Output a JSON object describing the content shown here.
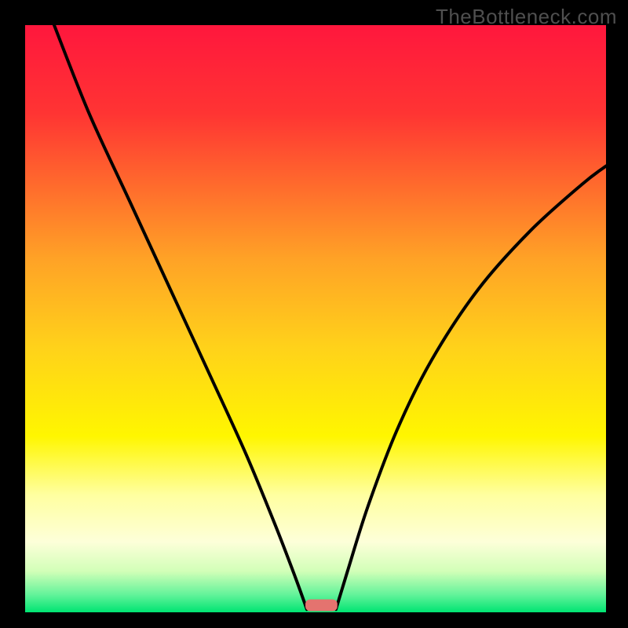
{
  "watermark": "TheBottleneck.com",
  "chart_data": {
    "type": "line",
    "title": "",
    "xlabel": "",
    "ylabel": "",
    "xlim": [
      0,
      100
    ],
    "ylim": [
      0,
      100
    ],
    "background_gradient_stops": [
      {
        "offset": 0.0,
        "color": "#ff173d"
      },
      {
        "offset": 0.15,
        "color": "#ff3433"
      },
      {
        "offset": 0.4,
        "color": "#ffa326"
      },
      {
        "offset": 0.55,
        "color": "#ffd21a"
      },
      {
        "offset": 0.7,
        "color": "#fff600"
      },
      {
        "offset": 0.8,
        "color": "#ffffa0"
      },
      {
        "offset": 0.88,
        "color": "#fdffd9"
      },
      {
        "offset": 0.93,
        "color": "#d2ffb8"
      },
      {
        "offset": 0.97,
        "color": "#63f39a"
      },
      {
        "offset": 1.0,
        "color": "#00e472"
      }
    ],
    "series": [
      {
        "name": "left-curve",
        "points": [
          {
            "x": 5.0,
            "y": 100.0
          },
          {
            "x": 11.0,
            "y": 85.0
          },
          {
            "x": 18.0,
            "y": 70.0
          },
          {
            "x": 25.0,
            "y": 55.0
          },
          {
            "x": 32.0,
            "y": 40.0
          },
          {
            "x": 38.0,
            "y": 27.0
          },
          {
            "x": 43.0,
            "y": 15.0
          },
          {
            "x": 46.5,
            "y": 6.0
          },
          {
            "x": 48.5,
            "y": 0.5
          }
        ]
      },
      {
        "name": "right-curve",
        "points": [
          {
            "x": 53.5,
            "y": 0.5
          },
          {
            "x": 55.5,
            "y": 7.0
          },
          {
            "x": 59.0,
            "y": 18.0
          },
          {
            "x": 64.0,
            "y": 31.0
          },
          {
            "x": 70.0,
            "y": 43.0
          },
          {
            "x": 78.0,
            "y": 55.0
          },
          {
            "x": 87.0,
            "y": 65.0
          },
          {
            "x": 96.0,
            "y": 73.0
          },
          {
            "x": 100.0,
            "y": 76.0
          }
        ]
      }
    ],
    "marker": {
      "x_center": 51.0,
      "width": 5.5,
      "height": 2.0,
      "y": 0.2,
      "color": "#e4736f"
    },
    "frame": {
      "inner_left": 4.0,
      "inner_right": 96.5,
      "inner_top": 4.0,
      "inner_bottom": 97.5,
      "frame_color": "#000000"
    }
  }
}
